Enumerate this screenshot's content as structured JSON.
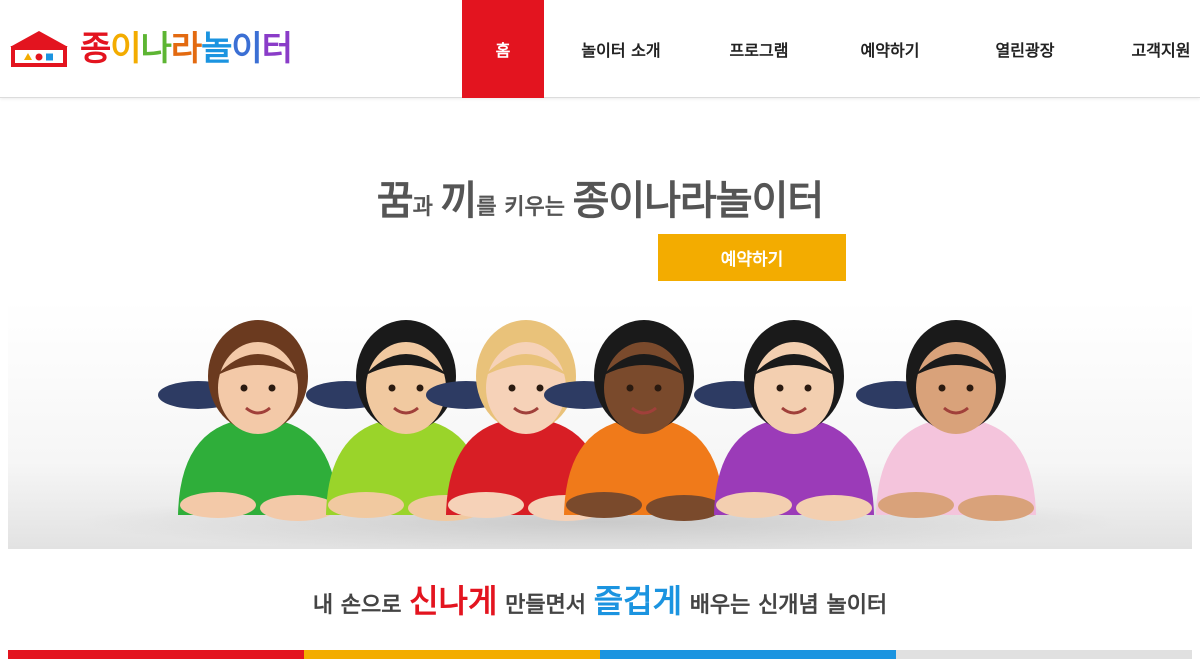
{
  "logo": {
    "name": "종이나라놀이터",
    "letters": [
      {
        "char": "종",
        "color": "#e3141f"
      },
      {
        "char": "이",
        "color": "#f3ac00"
      },
      {
        "char": "나",
        "color": "#5db533"
      },
      {
        "char": "라",
        "color": "#e36a10"
      },
      {
        "char": "놀",
        "color": "#1b94e0"
      },
      {
        "char": "이",
        "color": "#3b6fd4"
      },
      {
        "char": "터",
        "color": "#8a3cc8"
      }
    ]
  },
  "nav": {
    "items": [
      {
        "label": "홈",
        "active": true
      },
      {
        "label": "놀이터 소개",
        "active": false
      },
      {
        "label": "프로그램",
        "active": false
      },
      {
        "label": "예약하기",
        "active": false
      },
      {
        "label": "열린광장",
        "active": false
      },
      {
        "label": "고객지원",
        "active": false
      }
    ]
  },
  "hero": {
    "title_parts": [
      "꿈",
      "과 ",
      "끼",
      "를 키우는 ",
      "종이나라놀이터"
    ],
    "button_label": "예약하기"
  },
  "tagline": {
    "part1": "내 손으로 ",
    "highlight1": "신나게",
    "part2": " 만들면서 ",
    "highlight2": "즐겁게",
    "part3": " 배우는 신개념 놀이터"
  },
  "colors": {
    "accent_red": "#e3141f",
    "accent_yellow": "#f3ac00",
    "accent_blue": "#1b94e0",
    "bar": [
      "#e3141f",
      "#f3ac00",
      "#1b94e0",
      "#e0e0e0"
    ]
  },
  "kids": [
    {
      "shirt": "#2fae3a",
      "hair": "#6b3a1f",
      "skin": "#f3c9a8"
    },
    {
      "shirt": "#9ad42a",
      "hair": "#1a1a1a",
      "skin": "#f1c9a0"
    },
    {
      "shirt": "#d81e25",
      "hair": "#e9c27a",
      "skin": "#f6d2b8"
    },
    {
      "shirt": "#f07a1a",
      "hair": "#1a1a1a",
      "skin": "#7a4a2c"
    },
    {
      "shirt": "#9b3bb8",
      "hair": "#1a1a1a",
      "skin": "#f3cfb0"
    },
    {
      "shirt": "#f4c4dc",
      "hair": "#1a1a1a",
      "skin": "#d9a27a"
    }
  ]
}
